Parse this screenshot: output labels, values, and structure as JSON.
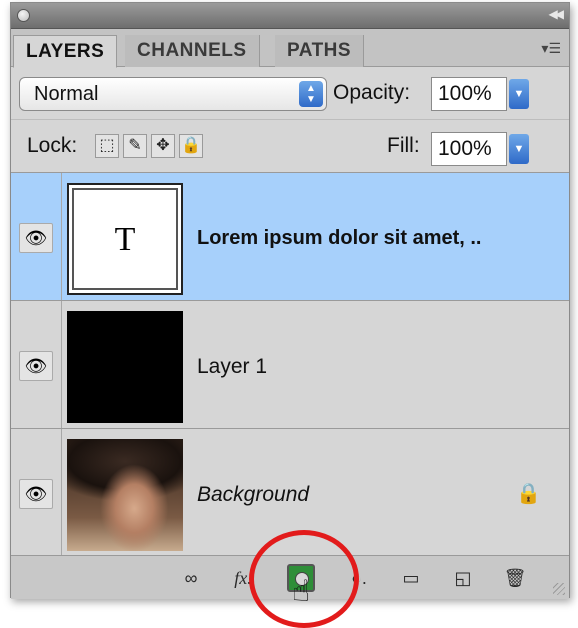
{
  "tabs": [
    {
      "label": "LAYERS"
    },
    {
      "label": "CHANNELS"
    },
    {
      "label": "PATHS"
    }
  ],
  "blend": {
    "value": "Normal"
  },
  "opacity": {
    "label": "Opacity:",
    "value": "100%"
  },
  "lock": {
    "label": "Lock:"
  },
  "fill": {
    "label": "Fill:",
    "value": "100%"
  },
  "layers": [
    {
      "name": "Lorem ipsum dolor sit amet, ..",
      "thumb_text": "T",
      "selected": true
    },
    {
      "name": "Layer 1",
      "selected": false
    },
    {
      "name": "Background",
      "locked": true,
      "selected": false
    }
  ],
  "colors": {
    "selected_row": "#a7d0fb",
    "highlight": "#e21b1b",
    "mask_button": "#2e8e38"
  },
  "icons": {
    "visibility": "eye-icon",
    "link": "link-icon",
    "fx": "fx-icon",
    "mask": "add-mask-icon",
    "adjustment": "adjustment-layer-icon",
    "group": "folder-icon",
    "new_layer": "new-layer-icon",
    "delete": "trash-icon"
  }
}
